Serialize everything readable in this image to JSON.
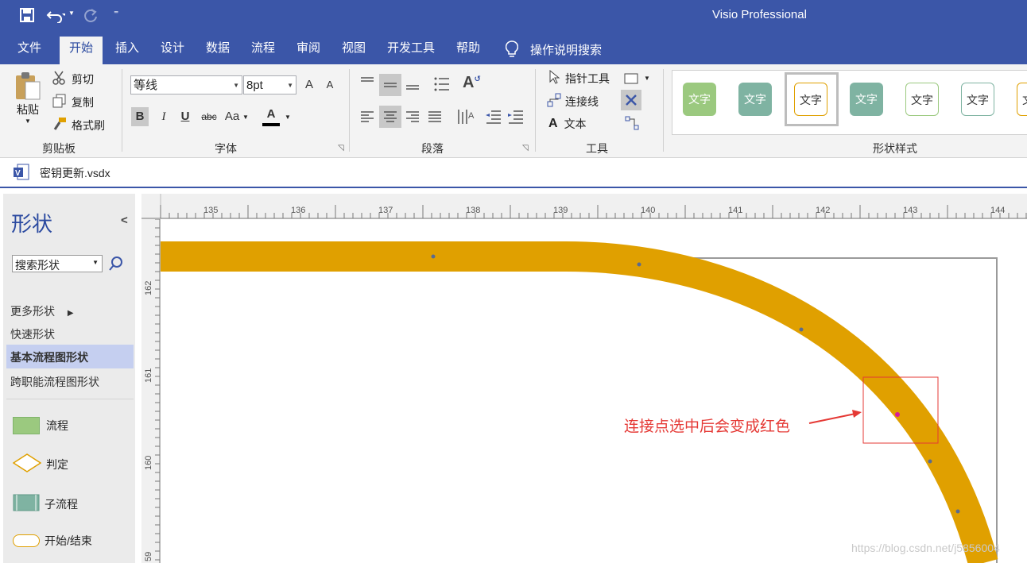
{
  "titlebar": {
    "app_title": "Visio Professional",
    "qat_more": "⁼"
  },
  "tabs": [
    {
      "label": "文件"
    },
    {
      "label": "开始"
    },
    {
      "label": "插入"
    },
    {
      "label": "设计"
    },
    {
      "label": "数据"
    },
    {
      "label": "流程"
    },
    {
      "label": "审阅"
    },
    {
      "label": "视图"
    },
    {
      "label": "开发工具"
    },
    {
      "label": "帮助"
    }
  ],
  "tell_me": "操作说明搜索",
  "clipboard": {
    "paste": "粘贴",
    "cut": "剪切",
    "copy": "复制",
    "format_painter": "格式刷",
    "group": "剪贴板"
  },
  "font": {
    "family": "等线",
    "size": "8pt",
    "grow": "A",
    "shrink": "A",
    "bold": "B",
    "italic": "I",
    "underline": "U",
    "strike": "abc",
    "case": "Aa",
    "color_label": "A",
    "group": "字体"
  },
  "paragraph": {
    "group": "段落"
  },
  "tools": {
    "pointer": "指针工具",
    "connector": "连接线",
    "text_letter": "A",
    "text": "文本",
    "group": "工具"
  },
  "shape_styles": {
    "group": "形状样式",
    "swatch_text": "文字",
    "colors": [
      "#9bc97f",
      "#7fb3a2",
      "#ffffff",
      "#7fb3a2",
      "#ffffff",
      "#ffffff"
    ]
  },
  "document": {
    "filename": "密钥更新.vsdx",
    "icon_letter": "V"
  },
  "shapes_pane": {
    "title": "形状",
    "collapse": "<",
    "search_placeholder": "搜索形状",
    "more": "更多形状",
    "quick": "快速形状",
    "basic_flow": "基本流程图形状",
    "cross_func": "跨职能流程图形状",
    "stencils": [
      {
        "label": "流程"
      },
      {
        "label": "判定"
      },
      {
        "label": "子流程"
      },
      {
        "label": "开始/结束"
      }
    ]
  },
  "ruler": {
    "h_labels": [
      "135",
      "136",
      "137",
      "138",
      "139",
      "140",
      "141",
      "142",
      "143",
      "144"
    ],
    "v_labels": [
      "162",
      "161",
      "160",
      "59"
    ]
  },
  "annotation": {
    "text": "连接点选中后会变成红色",
    "color": "#e53935"
  },
  "watermark": "https://blog.csdn.net/j5856004",
  "colors": {
    "accent": "#3b56a8",
    "connector": "#e0a000",
    "selection_box": "#e53935"
  }
}
